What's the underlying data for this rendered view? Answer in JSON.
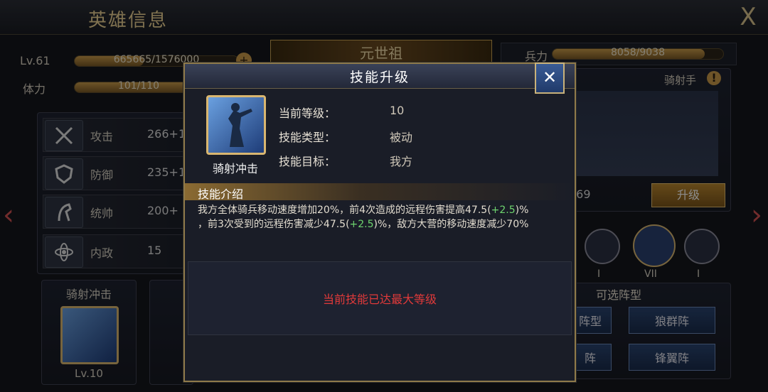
{
  "window": {
    "title": "英雄信息",
    "close_label": "X"
  },
  "hero": {
    "level_label": "Lv.61",
    "exp_text": "665665/1576000",
    "exp_fraction": 0.42,
    "stamina_label": "体力",
    "stamina_text": "101/110",
    "stamina_fraction": 0.92,
    "name": "元世祖",
    "troops_label": "兵力",
    "troops_text": "8058/9038",
    "troops_fraction": 0.89
  },
  "stats": [
    {
      "label": "攻击",
      "value": "266+1",
      "icon": "crossed-swords-icon"
    },
    {
      "label": "防御",
      "value": "235+1",
      "icon": "shield-icon"
    },
    {
      "label": "统帅",
      "value": "200+",
      "icon": "horse-head-icon"
    },
    {
      "label": "内政",
      "value": "15",
      "icon": "atom-icon"
    }
  ],
  "skill_card": {
    "title": "骑射冲击",
    "level": "Lv.10"
  },
  "army": {
    "type_label": "骑射手",
    "power": "169",
    "upgrade_label": "升级"
  },
  "formations": {
    "roman": [
      "I",
      "VII",
      "I"
    ],
    "title": "可选阵型",
    "buttons": [
      "阵型",
      "狼群阵",
      "阵",
      "锋翼阵"
    ]
  },
  "modal": {
    "title": "技能升级",
    "close_label": "✕",
    "skill_name": "骑射冲击",
    "rows": [
      {
        "key": "当前等级：",
        "value": "10"
      },
      {
        "key": "技能类型：",
        "value": "被动"
      },
      {
        "key": "技能目标：",
        "value": "我方"
      }
    ],
    "desc_title": "技能介绍",
    "desc_line1_a": "我方全体骑兵移动速度增加20%，前4次造成的远程伤害提高47.5(",
    "desc_line1_green": "+2.5",
    "desc_line1_b": ")%",
    "desc_line2_a": "，前3次受到的远程伤害减少47.5(",
    "desc_line2_green": "+2.5",
    "desc_line2_b": ")%，敌方大营的移动速度减少70%",
    "max_level_msg": "当前技能已达最大等级"
  },
  "colors": {
    "accent_gold": "#d9b670",
    "warning_red": "#e23a3a",
    "bonus_green": "#6ed46e"
  }
}
